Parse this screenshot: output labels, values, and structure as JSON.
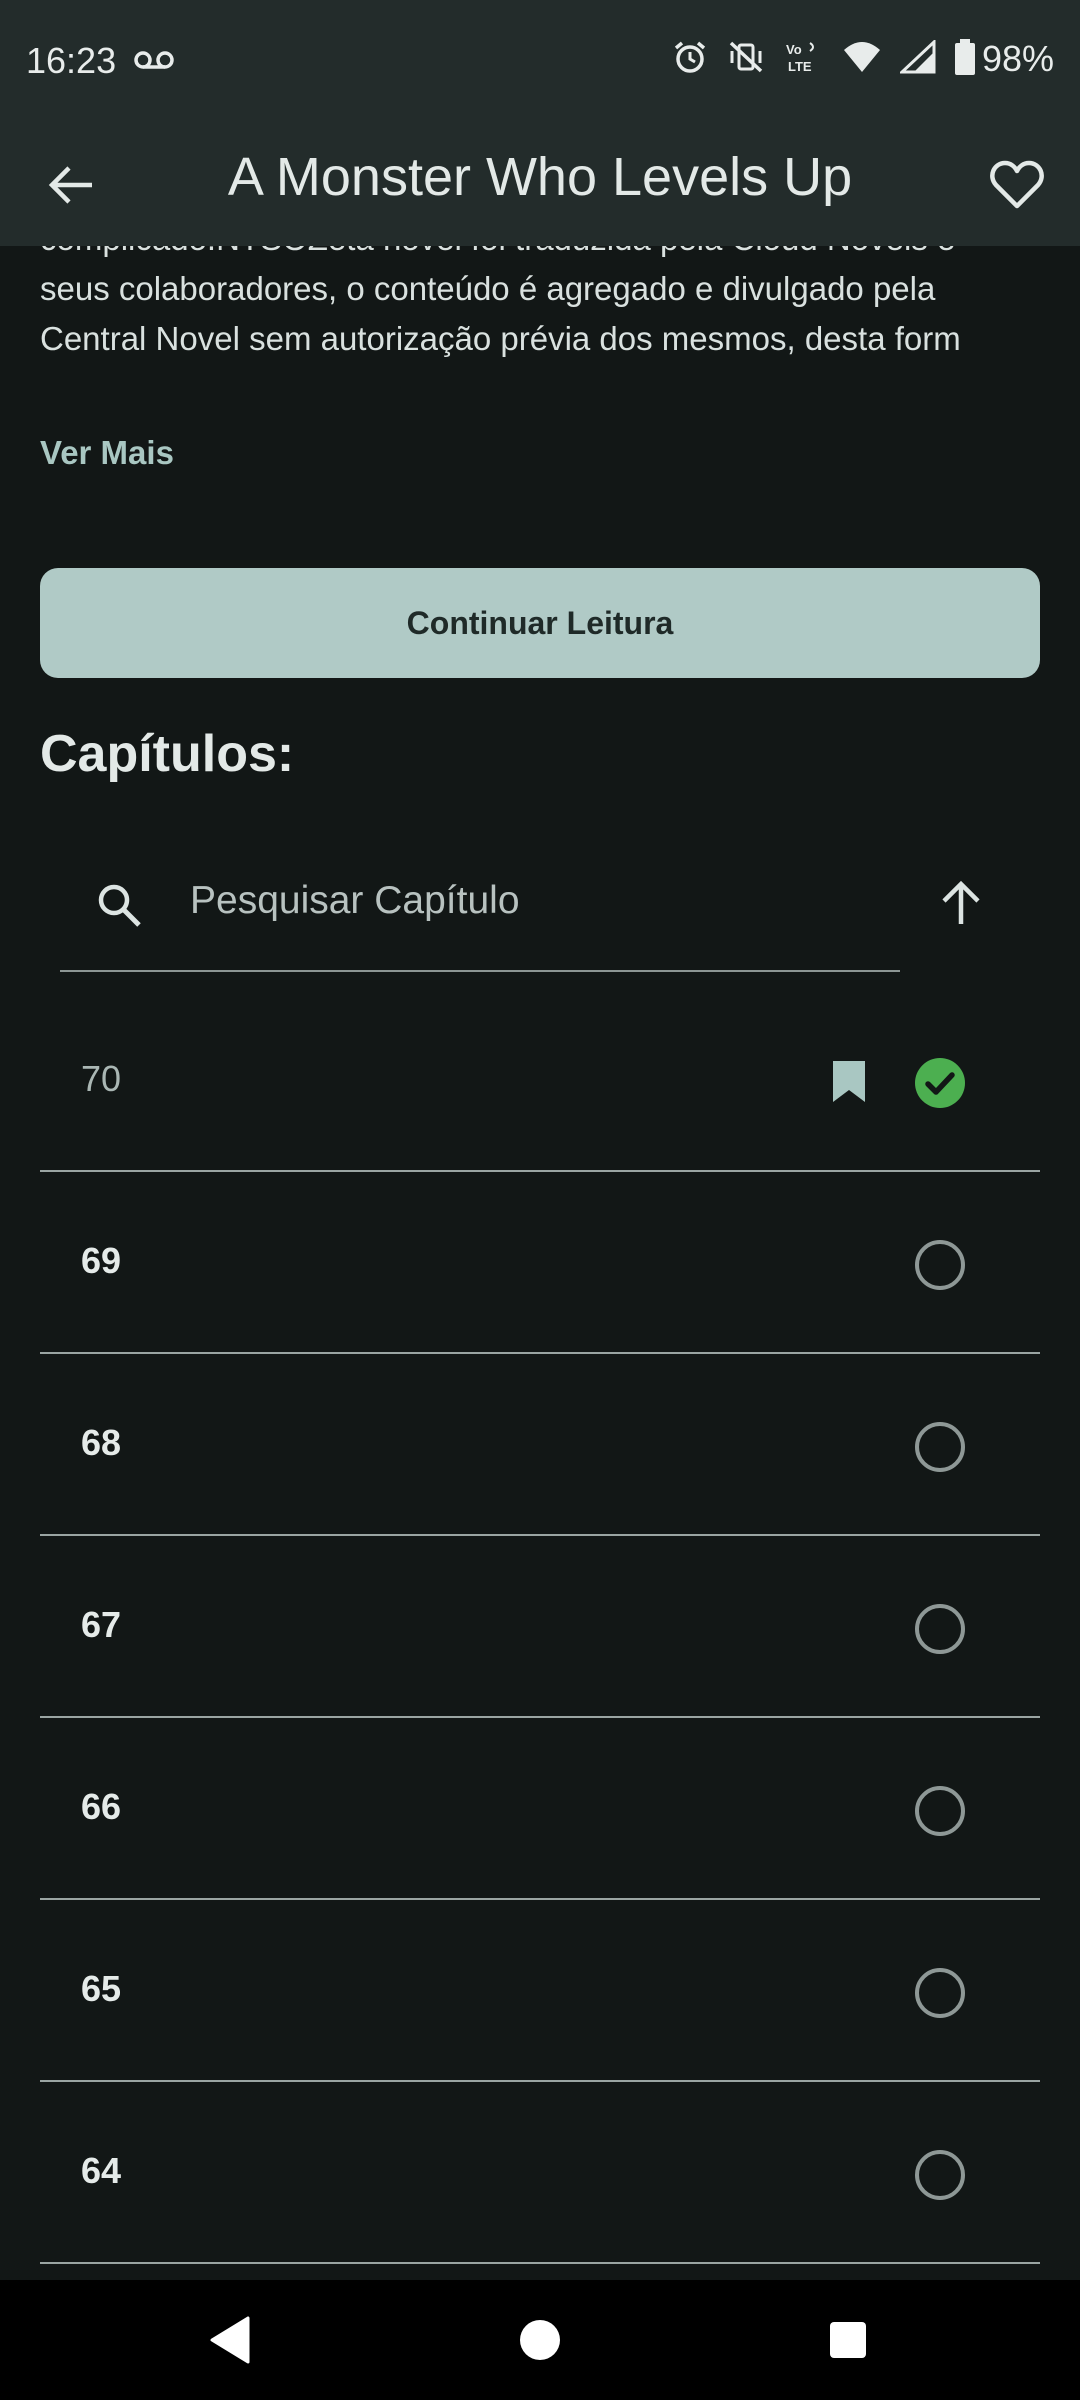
{
  "status_bar": {
    "time": "16:23",
    "battery": "98%",
    "icons": [
      "voicemail-icon",
      "alarm-icon",
      "vibrate-off-icon",
      "volte-icon",
      "wifi-icon",
      "signal-icon",
      "battery-icon"
    ]
  },
  "app_bar": {
    "title": "A Monster Who Levels Up",
    "back_icon": "arrow-left-icon",
    "favorite_icon": "heart-outline-icon"
  },
  "description": {
    "text": "complicado.NTSOZeta novel foi traduzida pela Cloud Novels e seus colaboradores, o conteúdo é agregado e divulgado pela Central Novel sem autorização prévia dos mesmos, desta form",
    "more_label": "Ver Mais"
  },
  "continue_button": "Continuar Leitura",
  "chapters_heading": "Capítulos:",
  "search": {
    "placeholder": "Pesquisar Capítulo",
    "value": ""
  },
  "chapters": [
    {
      "number": "70",
      "read": true,
      "bookmarked": true
    },
    {
      "number": "69",
      "read": false,
      "bookmarked": false
    },
    {
      "number": "68",
      "read": false,
      "bookmarked": false
    },
    {
      "number": "67",
      "read": false,
      "bookmarked": false
    },
    {
      "number": "66",
      "read": false,
      "bookmarked": false
    },
    {
      "number": "65",
      "read": false,
      "bookmarked": false
    },
    {
      "number": "64",
      "read": false,
      "bookmarked": false
    }
  ],
  "colors": {
    "accent": "#b0cac6",
    "read_check": "#4caf50",
    "background": "#121716",
    "app_bar": "#232c2b"
  }
}
